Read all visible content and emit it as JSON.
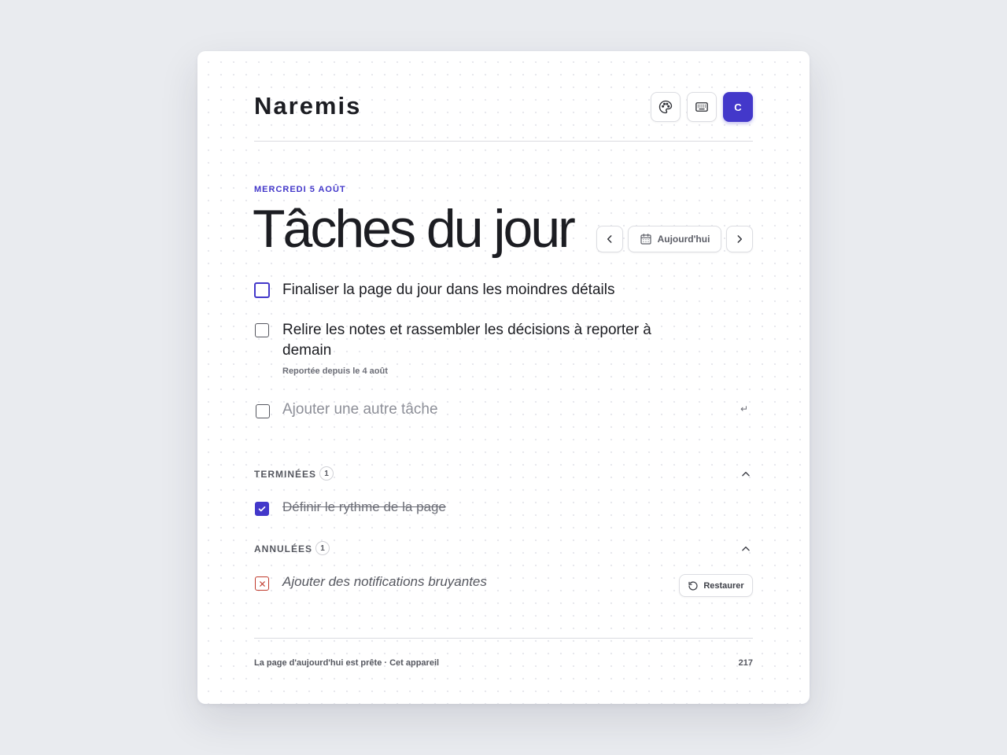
{
  "app": {
    "name": "Naremis",
    "avatar_initial": "C"
  },
  "header": {
    "actions": [
      {
        "name": "palette-icon"
      },
      {
        "name": "keyboard-icon"
      }
    ]
  },
  "page": {
    "date_label": "MERCREDI 5 AOÛT",
    "title": "Tâches du jour",
    "today_button": "Aujourd'hui"
  },
  "tasks": [
    {
      "text": "Finaliser la page du jour dans les moindres détails",
      "state": "active"
    },
    {
      "text_line1": "Relire les notes et rassembler les décisions à reporter à",
      "text_line2": "demain",
      "note": "Reportée depuis le 4 août",
      "state": "open"
    }
  ],
  "new_task": {
    "placeholder": "Ajouter une autre tâche",
    "enter_hint": "↵"
  },
  "completed": {
    "label": "TERMINÉES",
    "count": "1",
    "items": [
      {
        "text": "Définir le rythme de la page"
      }
    ]
  },
  "cancelled": {
    "label": "ANNULÉES",
    "count": "1",
    "items": [
      {
        "text": "Ajouter des notifications bruyantes",
        "restore_label": "Restaurer"
      }
    ]
  },
  "footer": {
    "status": "La page d'aujourd'hui est prête · Cet appareil",
    "count": "217"
  },
  "colors": {
    "accent": "#4338ca",
    "danger": "#c0392b",
    "background": "#e9ebef"
  }
}
